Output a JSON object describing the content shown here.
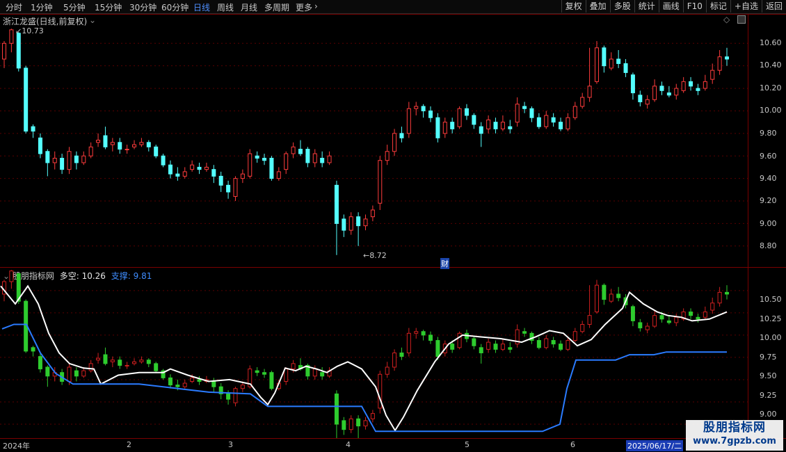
{
  "topbar": {
    "tabs": [
      "分时",
      "1分钟",
      "5分钟",
      "15分钟",
      "30分钟",
      "60分钟",
      "日线",
      "周线",
      "月线",
      "多周期",
      "更多"
    ],
    "active_tab": "日线",
    "more_chevron": "›",
    "tools": [
      "复权",
      "叠加",
      "多股",
      "统计",
      "画线",
      "F10",
      "标记",
      "+自选",
      "返回"
    ]
  },
  "main_chart": {
    "title": "浙江龙盛(日线,前复权)",
    "high_marker": "10.73",
    "low_marker": "8.72",
    "fin_badge": "财",
    "price_labels": [
      "10.60",
      "10.40",
      "10.20",
      "10.00",
      "9.80",
      "9.60",
      "9.40",
      "9.20",
      "9.00",
      "8.80"
    ]
  },
  "indicator": {
    "name": "股朋指标网",
    "duokong_label": "多空: 10.26",
    "zhicheng_label": "支撑: 9.81",
    "price_labels": [
      "10.50",
      "10.25",
      "10.00",
      "9.75",
      "9.50",
      "9.25",
      "9.00"
    ]
  },
  "date_axis": {
    "labels": [
      "2024年",
      "2",
      "3",
      "4",
      "5",
      "6"
    ],
    "cursor_date": "2025/06/17/二"
  },
  "watermark": {
    "name": "股朋指标网",
    "url": "www.7gpzb.com"
  },
  "colors": {
    "up": "#ff3c3c",
    "down": "#54ffff",
    "ind_up": "#d02020",
    "ind_down": "#2ecc2e",
    "white_line": "#ffffff",
    "support_line": "#2a7bff"
  },
  "chart_data": {
    "type": "candlestick",
    "series_main": [
      [
        10.46,
        10.6,
        10.62,
        10.38
      ],
      [
        10.6,
        10.72,
        10.73,
        10.52
      ],
      [
        10.69,
        10.38,
        10.7,
        10.35
      ],
      [
        10.38,
        9.82,
        10.4,
        9.8
      ],
      [
        9.86,
        9.82,
        9.88,
        9.76
      ],
      [
        9.76,
        9.62,
        9.8,
        9.58
      ],
      [
        9.64,
        9.54,
        9.66,
        9.42
      ],
      [
        9.54,
        9.58,
        9.64,
        9.48
      ],
      [
        9.58,
        9.48,
        9.62,
        9.44
      ],
      [
        9.48,
        9.64,
        9.68,
        9.44
      ],
      [
        9.6,
        9.54,
        9.64,
        9.48
      ],
      [
        9.54,
        9.6,
        9.64,
        9.52
      ],
      [
        9.6,
        9.68,
        9.72,
        9.58
      ],
      [
        9.72,
        9.74,
        9.8,
        9.68
      ],
      [
        9.78,
        9.68,
        9.86,
        9.66
      ],
      [
        9.7,
        9.72,
        9.76,
        9.64
      ],
      [
        9.72,
        9.66,
        9.76,
        9.62
      ],
      [
        9.66,
        9.66,
        9.7,
        9.62
      ],
      [
        9.68,
        9.7,
        9.74,
        9.66
      ],
      [
        9.7,
        9.72,
        9.76,
        9.68
      ],
      [
        9.72,
        9.68,
        9.74,
        9.64
      ],
      [
        9.68,
        9.6,
        9.7,
        9.58
      ],
      [
        9.6,
        9.52,
        9.62,
        9.5
      ],
      [
        9.52,
        9.44,
        9.56,
        9.4
      ],
      [
        9.44,
        9.42,
        9.5,
        9.38
      ],
      [
        9.42,
        9.46,
        9.5,
        9.4
      ],
      [
        9.48,
        9.52,
        9.56,
        9.46
      ],
      [
        9.5,
        9.48,
        9.54,
        9.44
      ],
      [
        9.48,
        9.5,
        9.54,
        9.46
      ],
      [
        9.48,
        9.42,
        9.52,
        9.36
      ],
      [
        9.42,
        9.34,
        9.46,
        9.28
      ],
      [
        9.34,
        9.28,
        9.38,
        9.22
      ],
      [
        9.24,
        9.4,
        9.42,
        9.2
      ],
      [
        9.4,
        9.44,
        9.48,
        9.36
      ],
      [
        9.42,
        9.62,
        9.66,
        9.4
      ],
      [
        9.6,
        9.58,
        9.64,
        9.54
      ],
      [
        9.58,
        9.56,
        9.62,
        9.52
      ],
      [
        9.58,
        9.4,
        9.6,
        9.38
      ],
      [
        9.4,
        9.46,
        9.5,
        9.38
      ],
      [
        9.48,
        9.62,
        9.64,
        9.44
      ],
      [
        9.62,
        9.68,
        9.72,
        9.58
      ],
      [
        9.66,
        9.62,
        9.74,
        9.6
      ],
      [
        9.66,
        9.54,
        9.68,
        9.5
      ],
      [
        9.54,
        9.62,
        9.66,
        9.5
      ],
      [
        9.58,
        9.54,
        9.64,
        9.5
      ],
      [
        9.54,
        9.6,
        9.64,
        9.52
      ],
      [
        9.34,
        9.0,
        9.38,
        8.72
      ],
      [
        9.04,
        8.94,
        9.08,
        8.88
      ],
      [
        8.94,
        9.06,
        9.1,
        8.9
      ],
      [
        9.06,
        8.98,
        9.1,
        8.8
      ],
      [
        8.98,
        9.04,
        9.08,
        8.94
      ],
      [
        9.06,
        9.12,
        9.16,
        9.02
      ],
      [
        9.18,
        9.56,
        9.6,
        9.12
      ],
      [
        9.56,
        9.64,
        9.7,
        9.52
      ],
      [
        9.64,
        9.8,
        9.84,
        9.6
      ],
      [
        9.8,
        9.76,
        9.86,
        9.72
      ],
      [
        9.8,
        10.02,
        10.08,
        9.76
      ],
      [
        10.02,
        10.04,
        10.08,
        9.96
      ],
      [
        10.04,
        10.0,
        10.06,
        9.94
      ],
      [
        10.0,
        9.94,
        10.04,
        9.9
      ],
      [
        9.94,
        9.76,
        9.98,
        9.72
      ],
      [
        9.8,
        9.9,
        9.94,
        9.76
      ],
      [
        9.9,
        9.84,
        9.94,
        9.8
      ],
      [
        9.86,
        10.02,
        10.04,
        9.84
      ],
      [
        10.02,
        9.96,
        10.06,
        9.92
      ],
      [
        9.96,
        9.88,
        9.98,
        9.84
      ],
      [
        9.86,
        9.8,
        9.9,
        9.68
      ],
      [
        9.84,
        9.92,
        9.96,
        9.8
      ],
      [
        9.9,
        9.84,
        9.94,
        9.8
      ],
      [
        9.84,
        9.9,
        9.96,
        9.82
      ],
      [
        9.86,
        9.84,
        9.92,
        9.8
      ],
      [
        9.9,
        10.06,
        10.12,
        9.86
      ],
      [
        10.04,
        10.02,
        10.08,
        9.98
      ],
      [
        10.02,
        9.94,
        10.04,
        9.9
      ],
      [
        9.94,
        9.86,
        9.98,
        9.84
      ],
      [
        9.86,
        9.96,
        10.0,
        9.84
      ],
      [
        9.94,
        9.9,
        9.98,
        9.86
      ],
      [
        9.9,
        9.84,
        9.94,
        9.82
      ],
      [
        9.84,
        9.94,
        9.98,
        9.82
      ],
      [
        9.94,
        10.04,
        10.08,
        9.92
      ],
      [
        10.04,
        10.12,
        10.16,
        10.02
      ],
      [
        10.12,
        10.22,
        10.56,
        10.08
      ],
      [
        10.26,
        10.56,
        10.62,
        10.24
      ],
      [
        10.56,
        10.4,
        10.58,
        10.34
      ],
      [
        10.38,
        10.46,
        10.52,
        10.36
      ],
      [
        10.46,
        10.42,
        10.54,
        10.38
      ],
      [
        10.42,
        10.34,
        10.46,
        10.3
      ],
      [
        10.32,
        10.16,
        10.34,
        10.1
      ],
      [
        10.14,
        10.08,
        10.18,
        10.04
      ],
      [
        10.06,
        10.1,
        10.14,
        10.02
      ],
      [
        10.1,
        10.22,
        10.28,
        10.08
      ],
      [
        10.22,
        10.18,
        10.26,
        10.14
      ],
      [
        10.16,
        10.14,
        10.22,
        10.12
      ],
      [
        10.14,
        10.2,
        10.24,
        10.1
      ],
      [
        10.18,
        10.26,
        10.3,
        10.16
      ],
      [
        10.26,
        10.22,
        10.3,
        10.18
      ],
      [
        10.2,
        10.18,
        10.24,
        10.14
      ],
      [
        10.2,
        10.26,
        10.32,
        10.18
      ],
      [
        10.28,
        10.36,
        10.42,
        10.24
      ],
      [
        10.36,
        10.48,
        10.54,
        10.32
      ],
      [
        10.48,
        10.46,
        10.56,
        10.4
      ]
    ],
    "white_line_xy": [
      [
        1,
        10.55
      ],
      [
        22,
        10.35
      ],
      [
        40,
        10.55
      ],
      [
        55,
        10.35
      ],
      [
        70,
        10.02
      ],
      [
        85,
        9.8
      ],
      [
        100,
        9.68
      ],
      [
        120,
        9.63
      ],
      [
        135,
        9.62
      ],
      [
        145,
        9.45
      ],
      [
        170,
        9.55
      ],
      [
        200,
        9.58
      ],
      [
        235,
        9.58
      ],
      [
        245,
        9.62
      ],
      [
        270,
        9.55
      ],
      [
        300,
        9.48
      ],
      [
        330,
        9.5
      ],
      [
        360,
        9.45
      ],
      [
        375,
        9.3
      ],
      [
        385,
        9.22
      ],
      [
        395,
        9.35
      ],
      [
        410,
        9.63
      ],
      [
        425,
        9.6
      ],
      [
        440,
        9.65
      ],
      [
        455,
        9.62
      ],
      [
        470,
        9.58
      ],
      [
        485,
        9.65
      ],
      [
        500,
        9.7
      ],
      [
        520,
        9.62
      ],
      [
        540,
        9.42
      ],
      [
        555,
        9.1
      ],
      [
        568,
        8.93
      ],
      [
        580,
        9.08
      ],
      [
        600,
        9.38
      ],
      [
        625,
        9.7
      ],
      [
        645,
        9.9
      ],
      [
        665,
        10.0
      ],
      [
        690,
        9.98
      ],
      [
        720,
        9.96
      ],
      [
        750,
        9.92
      ],
      [
        770,
        9.98
      ],
      [
        790,
        10.05
      ],
      [
        810,
        10.02
      ],
      [
        830,
        9.88
      ],
      [
        850,
        9.95
      ],
      [
        870,
        10.12
      ],
      [
        895,
        10.3
      ],
      [
        905,
        10.48
      ],
      [
        925,
        10.35
      ],
      [
        945,
        10.26
      ],
      [
        960,
        10.22
      ],
      [
        980,
        10.2
      ],
      [
        995,
        10.16
      ],
      [
        1020,
        10.18
      ],
      [
        1045,
        10.26
      ]
    ],
    "support_line_xy": [
      [
        3,
        10.07
      ],
      [
        20,
        10.12
      ],
      [
        38,
        10.12
      ],
      [
        58,
        9.8
      ],
      [
        80,
        9.57
      ],
      [
        105,
        9.45
      ],
      [
        200,
        9.45
      ],
      [
        300,
        9.36
      ],
      [
        360,
        9.34
      ],
      [
        385,
        9.2
      ],
      [
        520,
        9.2
      ],
      [
        540,
        8.92
      ],
      [
        780,
        8.92
      ],
      [
        805,
        9.0
      ],
      [
        815,
        9.4
      ],
      [
        828,
        9.72
      ],
      [
        885,
        9.72
      ],
      [
        905,
        9.78
      ],
      [
        940,
        9.78
      ],
      [
        958,
        9.81
      ],
      [
        1045,
        9.81
      ]
    ],
    "main_ylim": [
      8.7,
      10.75
    ],
    "indicator_ylim": [
      9.0,
      10.6
    ]
  }
}
